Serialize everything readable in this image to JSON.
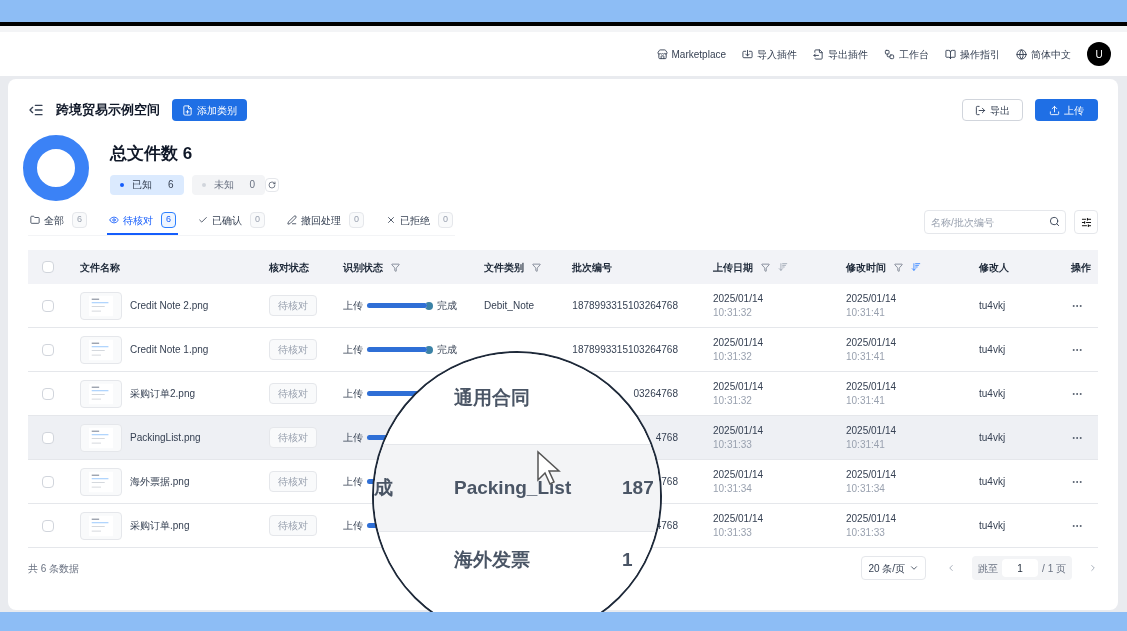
{
  "topnav": {
    "items": [
      {
        "kind": "store",
        "label": "Marketplace"
      },
      {
        "kind": "import",
        "label": "导入插件"
      },
      {
        "kind": "export",
        "label": "导出插件"
      },
      {
        "kind": "workbench",
        "label": "工作台"
      },
      {
        "kind": "guide",
        "label": "操作指引"
      },
      {
        "kind": "globe",
        "label": "简体中文"
      }
    ],
    "avatar": "U"
  },
  "header": {
    "title": "跨境贸易示例空间",
    "add_button": "添加类别",
    "export_button": "导出",
    "upload_button": "上传"
  },
  "summary": {
    "title": "总文件数 6",
    "legend": [
      {
        "label": "已知",
        "count": "6",
        "selected": true
      },
      {
        "label": "未知",
        "count": "0",
        "selected": false
      }
    ]
  },
  "tabs": [
    {
      "kind": "all",
      "label": "全部",
      "count": "6",
      "selected": false
    },
    {
      "kind": "pending",
      "label": "待核对",
      "count": "6",
      "selected": true
    },
    {
      "kind": "confirmed",
      "label": "已确认",
      "count": "0",
      "selected": false
    },
    {
      "kind": "withdrawn",
      "label": "撤回处理",
      "count": "0",
      "selected": false
    },
    {
      "kind": "rejected",
      "label": "已拒绝",
      "count": "0",
      "selected": false
    }
  ],
  "search": {
    "placeholder": "名称/批次编号"
  },
  "table": {
    "select_all": {
      "checked": false
    },
    "columns": [
      {
        "label": "文件名称"
      },
      {
        "label": "核对状态"
      },
      {
        "label": "识别状态",
        "filter": true
      },
      {
        "label": "文件类别",
        "filter": true
      },
      {
        "label": "批次编号"
      },
      {
        "label": "上传日期",
        "filter": true,
        "sorted": false
      },
      {
        "label": "修改时间",
        "filter": true,
        "sorted": true
      },
      {
        "label": "修改人"
      },
      {
        "label": "操作"
      }
    ],
    "rows": [
      {
        "checked": false,
        "highlighted": false,
        "name": "Credit Note 2.png",
        "review": "待核对",
        "progress_start": "上传",
        "level": 1,
        "progress_end": "完成",
        "category": "Debit_Note",
        "batch": "1878993315103264768",
        "upload_date": "2025/01/14",
        "upload_time": "10:31:32",
        "modified_date": "2025/01/14",
        "modified_time": "10:31:41",
        "modifier": "tu4vkj"
      },
      {
        "checked": false,
        "highlighted": false,
        "name": "Credit Note 1.png",
        "review": "待核对",
        "progress_start": "上传",
        "level": 1,
        "progress_end": "完成",
        "batch": "1878993315103264768",
        "upload_date": "2025/01/14",
        "upload_time": "10:31:32",
        "modified_date": "2025/01/14",
        "modified_time": "10:31:41",
        "modifier": "tu4vkj"
      },
      {
        "checked": false,
        "highlighted": false,
        "name": "采购订单2.png",
        "review": "待核对",
        "progress_start": "上传",
        "level": 1,
        "batch": "03264768",
        "upload_date": "2025/01/14",
        "upload_time": "10:31:32",
        "modified_date": "2025/01/14",
        "modified_time": "10:31:41",
        "modifier": "tu4vkj"
      },
      {
        "checked": false,
        "highlighted": true,
        "name": "PackingList.png",
        "review": "待核对",
        "progress_start": "上传",
        "level": 1,
        "batch": "4768",
        "upload_date": "2025/01/14",
        "upload_time": "10:31:33",
        "modified_date": "2025/01/14",
        "modified_time": "10:31:41",
        "modifier": "tu4vkj"
      },
      {
        "checked": false,
        "highlighted": false,
        "name": "海外票据.png",
        "review": "待核对",
        "progress_start": "上传",
        "level": 1,
        "batch": "768",
        "upload_date": "2025/01/14",
        "upload_time": "10:31:34",
        "modified_date": "2025/01/14",
        "modified_time": "10:31:34",
        "modifier": "tu4vkj"
      },
      {
        "checked": false,
        "highlighted": false,
        "name": "采购订单.png",
        "review": "待核对",
        "progress_start": "上传",
        "level": 1,
        "batch": "4768",
        "upload_date": "2025/01/14",
        "upload_time": "10:31:33",
        "modified_date": "2025/01/14",
        "modified_time": "10:31:33",
        "modifier": "tu4vkj"
      }
    ]
  },
  "footer": {
    "total": "共 6 条数据",
    "page_size": "20 条/页",
    "jump_label": "跳至",
    "page": "1",
    "pages": "/ 1 页"
  },
  "magnifier": {
    "rows": [
      {
        "highlighted": false,
        "category": "通用合同"
      },
      {
        "highlighted": true,
        "progress_end": "成",
        "category": "Packing_List",
        "batch": "187"
      },
      {
        "highlighted": false,
        "category": "海外发票",
        "batch": "1"
      }
    ]
  }
}
